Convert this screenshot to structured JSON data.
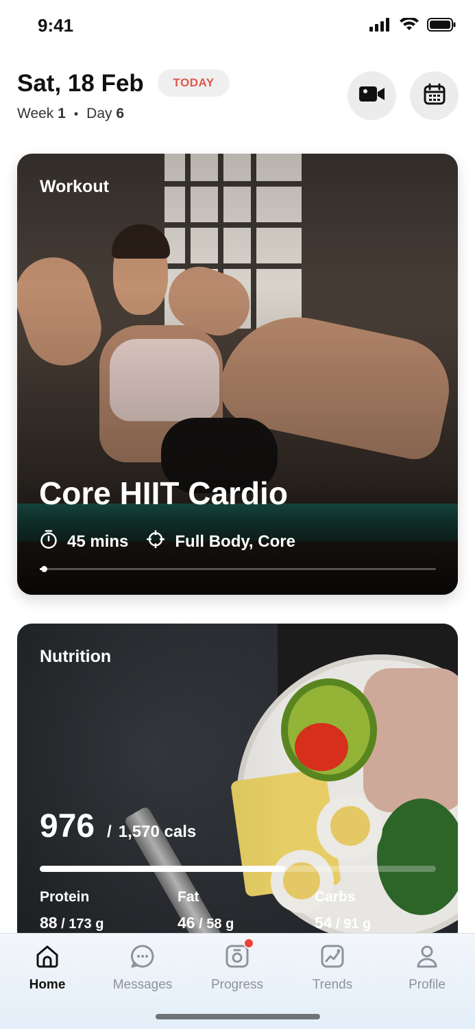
{
  "status_bar": {
    "time": "9:41"
  },
  "header": {
    "date": "Sat, 18 Feb",
    "today_badge": "TODAY",
    "week_label": "Week",
    "week_value": "1",
    "day_label": "Day",
    "day_value": "6",
    "separator": "•"
  },
  "workout": {
    "section_label": "Workout",
    "title": "Core HIIT Cardio",
    "duration": "45 mins",
    "focus": "Full Body, Core",
    "progress": 0.01
  },
  "nutrition": {
    "section_label": "Nutrition",
    "calories_eaten": "976",
    "slash": "/",
    "calories_goal": "1,570 cals",
    "calories_progress": 0.62,
    "macros": [
      {
        "label": "Protein",
        "value": "88",
        "goal": "/ 173 g"
      },
      {
        "label": "Fat",
        "value": "46",
        "goal": "/ 58 g"
      },
      {
        "label": "Carbs",
        "value": "54",
        "goal": "/ 91 g"
      }
    ]
  },
  "tab_bar": {
    "tabs": [
      {
        "label": "Home",
        "icon": "home-icon",
        "active": true
      },
      {
        "label": "Messages",
        "icon": "messages-icon",
        "active": false
      },
      {
        "label": "Progress",
        "icon": "progress-icon",
        "active": false,
        "badge": true
      },
      {
        "label": "Trends",
        "icon": "trends-icon",
        "active": false
      },
      {
        "label": "Profile",
        "icon": "profile-icon",
        "active": false
      }
    ]
  },
  "colors": {
    "accent_red": "#e2554a",
    "badge_red": "#f04237",
    "tab_inactive": "#8d939a"
  }
}
